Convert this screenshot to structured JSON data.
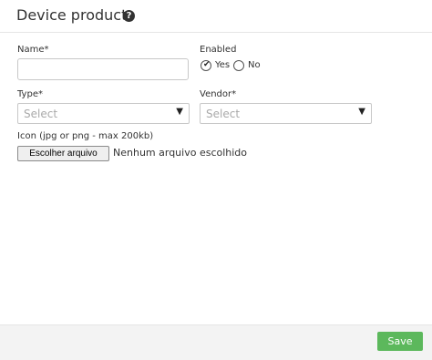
{
  "header": {
    "title": "Device product",
    "help_icon": "question-circle-icon"
  },
  "form": {
    "name": {
      "label": "Name*",
      "value": ""
    },
    "enabled": {
      "label": "Enabled",
      "options": [
        "Yes",
        "No"
      ],
      "selected": "Yes"
    },
    "type": {
      "label": "Type*",
      "selected": "Select"
    },
    "vendor": {
      "label": "Vendor*",
      "selected": "Select"
    },
    "icon": {
      "label": "Icon (jpg or png - max 200kb)",
      "button_label": "Escolher arquivo",
      "status": "Nenhum arquivo escolhido"
    }
  },
  "footer": {
    "save_label": "Save"
  },
  "colors": {
    "save_button": "#5cb85c",
    "footer_background": "#f3f3f3"
  }
}
